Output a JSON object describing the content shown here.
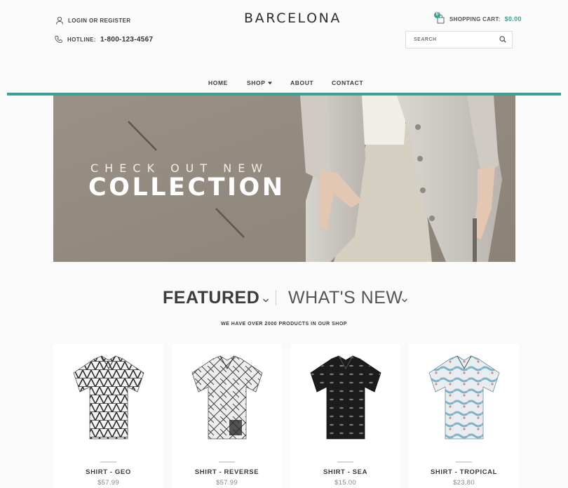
{
  "header": {
    "login_label": "Login or Register",
    "hotline_label": "Hotline:",
    "hotline_number": "1-800-123-4567",
    "logo": "BARCELONA",
    "cart_label": "Shopping Cart:",
    "cart_amount": "$0.00",
    "cart_count": "0",
    "search_placeholder": "Search"
  },
  "nav": {
    "items": [
      {
        "label": "Home"
      },
      {
        "label": "Shop"
      },
      {
        "label": "About"
      },
      {
        "label": "Contact"
      }
    ]
  },
  "hero": {
    "subtitle": "CHECK OUT NEW",
    "title": "COLLECTION"
  },
  "sections": {
    "tab_featured": "FEATURED",
    "tab_whats_new": "WHAT'S NEW",
    "tagline": "We have over 2000 products in our shop"
  },
  "products": [
    {
      "name": "Shirt - Geo",
      "price": "$57.99",
      "pattern": "geo-white"
    },
    {
      "name": "Shirt - Reverse",
      "price": "$57.99",
      "pattern": "reverse-white"
    },
    {
      "name": "Shirt - Sea",
      "price": "$15.00",
      "pattern": "sea-black"
    },
    {
      "name": "Shirt - Tropical",
      "price": "$23.80",
      "pattern": "tropical-blue"
    }
  ],
  "colors": {
    "accent": "#3aa393",
    "hero_bg": "#958c82"
  }
}
